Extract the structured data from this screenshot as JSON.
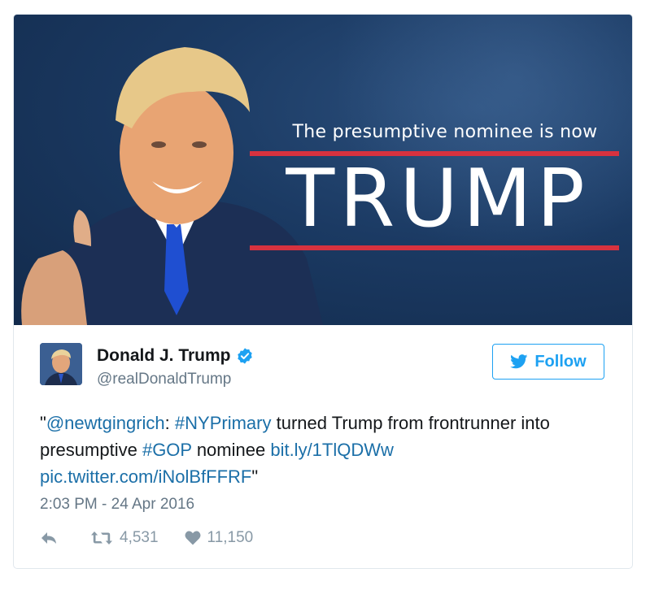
{
  "media": {
    "headline_small": "The presumptive nominee is now",
    "headline_big": "TRUMP",
    "colors": {
      "background": "#1b3a63",
      "rule": "#d7323f"
    }
  },
  "author": {
    "name": "Donald J. Trump",
    "handle": "@realDonaldTrump",
    "verified_icon": "verified-badge-icon"
  },
  "follow_button": {
    "label": "Follow",
    "icon": "twitter-bird-icon"
  },
  "tweet": {
    "quote_open": "\"",
    "mention": "@newtgingrich",
    "colon": ": ",
    "hashtag1": "#NYPrimary",
    "text1": " turned Trump from frontrunner into presumptive ",
    "hashtag2": "#GOP",
    "text2": " nominee ",
    "link": "bit.ly/1TlQDWw",
    "pic_link": "pic.twitter.com/iNolBfFFRF",
    "quote_close": "\""
  },
  "timestamp": "2:03 PM - 24 Apr 2016",
  "actions": {
    "reply_icon": "reply-icon",
    "retweet_icon": "retweet-icon",
    "retweet_count": "4,531",
    "like_icon": "heart-icon",
    "like_count": "11,150"
  },
  "colors": {
    "link": "#1b6fa8",
    "accent": "#1da1f2",
    "muted": "#657786"
  }
}
